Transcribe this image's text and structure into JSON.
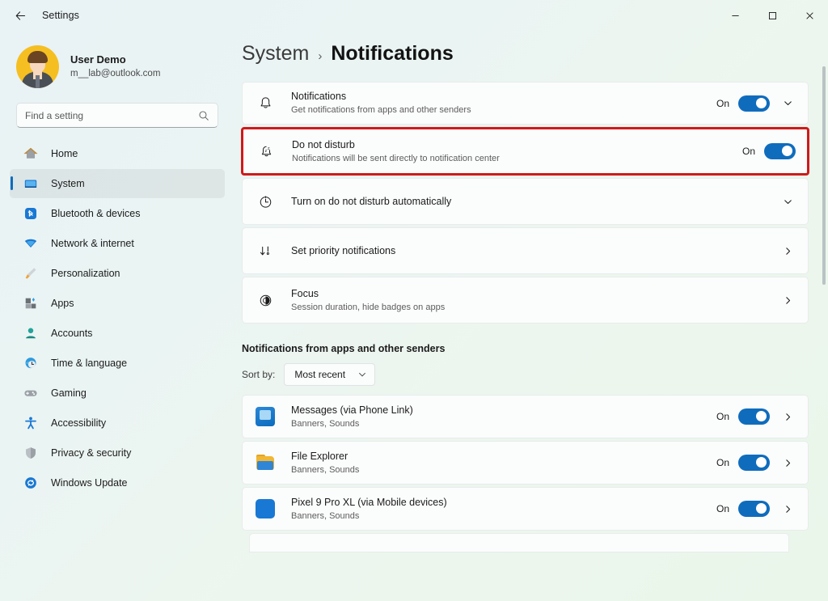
{
  "window": {
    "title": "Settings",
    "back_icon": "arrow-left-icon",
    "controls": {
      "minimize": "–",
      "maximize": "☐",
      "close": "✕"
    }
  },
  "sidebar": {
    "profile": {
      "name": "User Demo",
      "email": "m__lab@outlook.com"
    },
    "search": {
      "placeholder": "Find a setting",
      "value": "",
      "icon": "search-icon"
    },
    "items": [
      {
        "label": "Home",
        "icon": "home-icon",
        "active": false
      },
      {
        "label": "System",
        "icon": "monitor-icon",
        "active": true
      },
      {
        "label": "Bluetooth & devices",
        "icon": "bluetooth-icon",
        "active": false
      },
      {
        "label": "Network & internet",
        "icon": "wifi-icon",
        "active": false
      },
      {
        "label": "Personalization",
        "icon": "paintbrush-icon",
        "active": false
      },
      {
        "label": "Apps",
        "icon": "apps-icon",
        "active": false
      },
      {
        "label": "Accounts",
        "icon": "person-icon",
        "active": false
      },
      {
        "label": "Time & language",
        "icon": "clock-globe-icon",
        "active": false
      },
      {
        "label": "Gaming",
        "icon": "gamepad-icon",
        "active": false
      },
      {
        "label": "Accessibility",
        "icon": "accessibility-icon",
        "active": false
      },
      {
        "label": "Privacy & security",
        "icon": "shield-icon",
        "active": false
      },
      {
        "label": "Windows Update",
        "icon": "update-icon",
        "active": false
      }
    ]
  },
  "breadcrumb": {
    "parent": "System",
    "separator": "›",
    "current": "Notifications"
  },
  "settings_cards": [
    {
      "title": "Notifications",
      "subtitle": "Get notifications from apps and other senders",
      "icon": "bell-icon",
      "state": "On",
      "toggle": true,
      "trailing": "chevron-down-icon",
      "highlighted": false
    },
    {
      "title": "Do not disturb",
      "subtitle": "Notifications will be sent directly to notification center",
      "icon": "bell-sleep-icon",
      "state": "On",
      "toggle": true,
      "trailing": "none",
      "highlighted": true
    },
    {
      "title": "Turn on do not disturb automatically",
      "subtitle": "",
      "icon": "clock-icon",
      "state": "",
      "toggle": false,
      "trailing": "chevron-down-icon",
      "highlighted": false
    },
    {
      "title": "Set priority notifications",
      "subtitle": "",
      "icon": "priority-arrow-icon",
      "state": "",
      "toggle": false,
      "trailing": "chevron-right-icon",
      "highlighted": false
    },
    {
      "title": "Focus",
      "subtitle": "Session duration, hide badges on apps",
      "icon": "focus-icon",
      "state": "",
      "toggle": false,
      "trailing": "chevron-right-icon",
      "highlighted": false
    }
  ],
  "apps_section": {
    "heading": "Notifications from apps and other senders",
    "sort_label": "Sort by:",
    "sort_value": "Most recent",
    "sort_icon": "chevron-down-icon",
    "apps": [
      {
        "name": "Messages (via Phone Link)",
        "sub": "Banners, Sounds",
        "icon": "messages-app-icon",
        "state": "On",
        "toggle": true,
        "trailing": "chevron-right-icon"
      },
      {
        "name": "File Explorer",
        "sub": "Banners, Sounds",
        "icon": "file-explorer-app-icon",
        "state": "On",
        "toggle": true,
        "trailing": "chevron-right-icon"
      },
      {
        "name": "Pixel 9 Pro XL (via Mobile devices)",
        "sub": "Banners, Sounds",
        "icon": "pixel-app-icon",
        "state": "On",
        "toggle": true,
        "trailing": "chevron-right-icon"
      }
    ]
  },
  "colors": {
    "accent": "#0f6cbd",
    "highlight_border": "#cf1a1a",
    "card_bg": "#fbfcfc",
    "text_primary": "#1b1b1b",
    "text_secondary": "#5d5d5d"
  }
}
